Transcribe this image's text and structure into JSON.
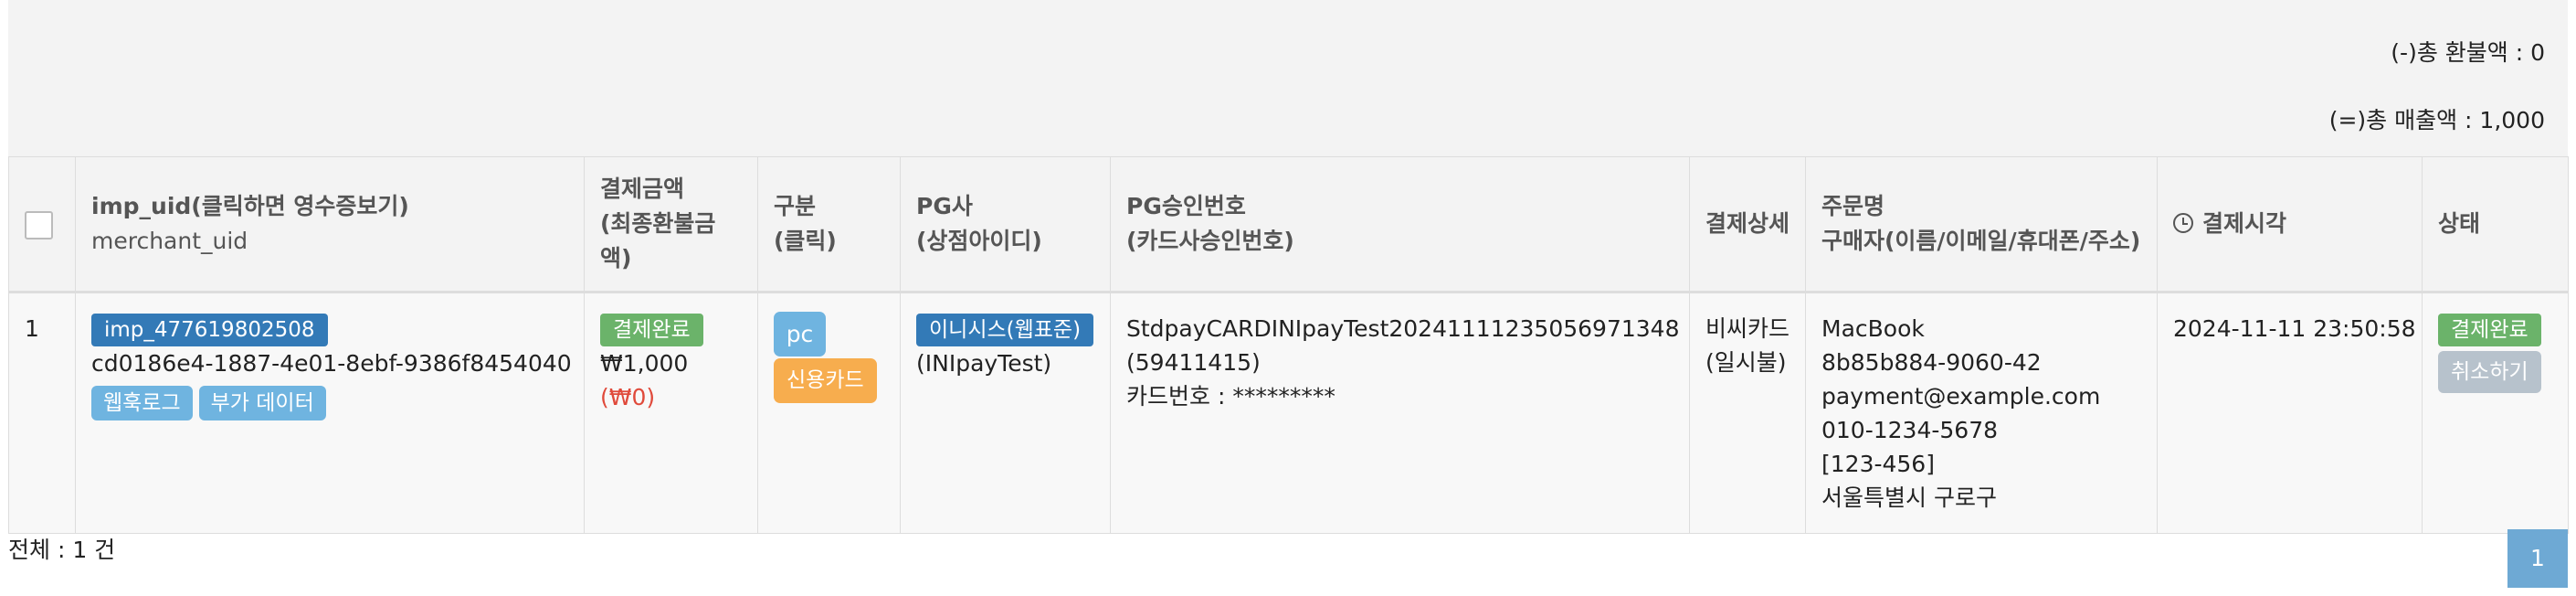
{
  "summary": {
    "total_refund": "(-)총 환불액 : 0",
    "total_sales": "(=)총 매출액 : 1,000"
  },
  "table": {
    "headers": {
      "uid_line1": "imp_uid(클릭하면 영수증보기)",
      "uid_line2": "merchant_uid",
      "amount_line1": "결제금액",
      "amount_line2": "(최종환불금액)",
      "type_line1": "구분",
      "type_line2": "(클릭)",
      "pg_line1": "PG사",
      "pg_line2": "(상점아이디)",
      "approval_line1": "PG승인번호",
      "approval_line2": "(카드사승인번호)",
      "detail": "결제상세",
      "order_line1": "주문명",
      "order_line2": "구매자(이름/이메일/휴대폰/주소)",
      "time": "결제시각",
      "status": "상태"
    },
    "rows": [
      {
        "index": "1",
        "imp_uid": "imp_477619802508",
        "merchant_uid": "cd0186e4-1887-4e01-8ebf-9386f8454040",
        "webhook_label": "웹훅로그",
        "extra_data_label": "부가 데이터",
        "amount_status": "결제완료",
        "amount": "₩1,000",
        "refund_amount": "(₩0)",
        "channel": "pc",
        "method": "신용카드",
        "pg": "이니시스(웹표준)",
        "merchant_id": "(INIpayTest)",
        "pg_tid": "StdpayCARDINIpayTest20241111235056971348",
        "card_approval": "(59411415)",
        "card_number": "카드번호 : *********",
        "detail_line1": "비씨카드",
        "detail_line2": "(일시불)",
        "order_name": "MacBook",
        "buyer_id": "8b85b884-9060-42",
        "buyer_email": "payment@example.com",
        "buyer_phone": "010-1234-5678",
        "buyer_postcode": "[123-456]",
        "buyer_address": "서울특별시 구로구",
        "paid_at": "2024-11-11 23:50:58",
        "status": "결제완료",
        "cancel_label": "취소하기"
      }
    ]
  },
  "footer": {
    "total_count": "전체 : 1 건",
    "page": "1"
  },
  "colors": {
    "dark_blue": "#337ab7",
    "green": "#6bb36a",
    "light_blue": "#6fb4e0",
    "orange": "#f7ad4e",
    "gray": "#b7c2cc",
    "refund_red": "#e04a3b",
    "pager_blue": "#6ea9d4"
  },
  "icons": {
    "time_header": "clock-icon"
  }
}
